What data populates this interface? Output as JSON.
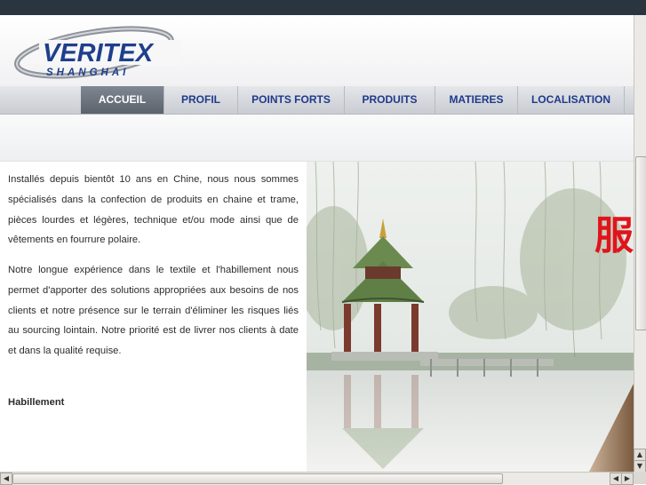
{
  "brand": {
    "name": "VERITEX",
    "city": "SHANGHAI"
  },
  "nav": {
    "items": [
      {
        "label": "ACCUEIL",
        "active": true
      },
      {
        "label": "PROFIL",
        "active": false
      },
      {
        "label": "POINTS FORTS",
        "active": false
      },
      {
        "label": "PRODUITS",
        "active": false
      },
      {
        "label": "MATIERES",
        "active": false
      },
      {
        "label": "LOCALISATION",
        "active": false
      }
    ]
  },
  "content": {
    "paragraphs": [
      "Installés depuis bientôt 10 ans en Chine, nous nous sommes spécialisés dans la confection de produits en chaine et trame, pièces lourdes et légères, technique et/ou mode ainsi que de vêtements en fourrure polaire.",
      "Notre longue expérience dans le textile et l'habillement nous permet d'apporter des solutions appropriées aux besoins de nos clients et notre présence sur le terrain d'éliminer les risques liés au sourcing lointain. Notre priorité est de livrer nos clients à date et dans la qualité requise."
    ],
    "category": "Habillement"
  },
  "photo": {
    "overlay_char": "服"
  },
  "icons": {
    "scroll_up": "arrow-up-icon",
    "scroll_down": "arrow-down-icon",
    "scroll_left": "arrow-left-icon",
    "scroll_right": "arrow-right-icon"
  },
  "colors": {
    "nav_text": "#1f3a8a",
    "active_tab": "#6b737d",
    "logo_blue": "#1f3f8c",
    "accent_red": "#e0141b",
    "top_bar": "#2b3540"
  }
}
